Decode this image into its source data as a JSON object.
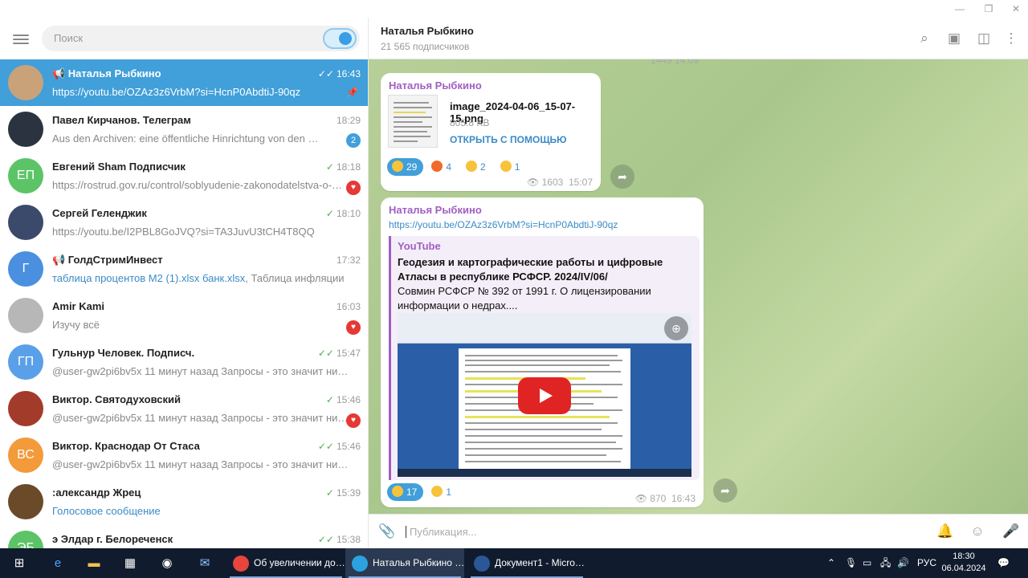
{
  "window": {
    "min": "—",
    "restore": "❐",
    "close": "✕"
  },
  "sidebar": {
    "search_placeholder": "Поиск",
    "chats": [
      {
        "name": "📢 Наталья Рыбкино",
        "time": "16:43",
        "preview": "https://youtu.be/OZAz3z6VrbM?si=HcnP0AbdtiJ-90qz",
        "check": "✓✓",
        "pinned": true,
        "avatar_color": "#c9a27a",
        "initials": ""
      },
      {
        "name": "Павел Кирчанов. Телеграм",
        "time": "18:29",
        "preview": "Aus den Archiven: eine öffentliche Hinrichtung von den …",
        "badge": "2",
        "avatar_color": "#2b3340",
        "initials": ""
      },
      {
        "name": "Евгений Sham Подписчик",
        "time": "18:18",
        "preview": "https://rostrud.gov.ru/control/soblyudenie-zakonodatelstva-o-…",
        "check": "✓",
        "heart": true,
        "avatar_color": "#5cc466",
        "initials": "ЕП"
      },
      {
        "name": "Сергей Геленджик",
        "time": "18:10",
        "preview": "https://youtu.be/I2PBL8GoJVQ?si=TA3JuvU3tCH4T8QQ",
        "check": "✓",
        "avatar_color": "#3b4a6b",
        "initials": ""
      },
      {
        "name": "📢 ГолдСтримИнвест",
        "time": "17:32",
        "preview_hl": "таблица процентов М2 (1).xlsx  банк.xlsx",
        "preview": ", Таблица инфляции",
        "avatar_color": "#4b8fe0",
        "initials": "Г"
      },
      {
        "name": "Amir Kami",
        "time": "16:03",
        "preview": "Изучу всё",
        "heart": true,
        "avatar_color": "#b7b7b7",
        "initials": ""
      },
      {
        "name": "Гульнур Человек. Подписч.",
        "time": "15:47",
        "preview": "@user-gw2pi6bv5x 11 минут назад Запросы - это значит ничего! …",
        "check": "✓✓",
        "avatar_color": "#5aa0e8",
        "initials": "ГП"
      },
      {
        "name": "Виктор. Святодуховский",
        "time": "15:46",
        "preview": "@user-gw2pi6bv5x 11 минут назад Запросы - это значит нич…",
        "check": "✓",
        "heart": true,
        "avatar_color": "#a33b2a",
        "initials": ""
      },
      {
        "name": "Виктор. Краснодар От Стаса",
        "time": "15:46",
        "preview": "@user-gw2pi6bv5x 11 минут назад Запросы - это значит ничего! …",
        "check": "✓✓",
        "avatar_color": "#f39a3a",
        "initials": "ВС"
      },
      {
        "name": ":александр Жрец",
        "time": "15:39",
        "preview_hl": "Голосовое сообщение",
        "preview": "",
        "check": "✓",
        "avatar_color": "#6b4a2a",
        "initials": ""
      },
      {
        "name": "э Элдар г. Белореченск",
        "time": "15:38",
        "preview": "",
        "check": "✓✓",
        "avatar_color": "#5cc466",
        "initials": "ЭБ"
      }
    ]
  },
  "chat": {
    "title": "Наталья Рыбкино",
    "subtitle": "21 565 подписчиков",
    "top_meta": "1449  14:09",
    "file_msg": {
      "sender": "Наталья Рыбкино",
      "file_name": "image_2024-04-06_15-07-15.png",
      "file_size": "805.8 KB",
      "open_label": "ОТКРЫТЬ С ПОМОЩЬЮ",
      "reactions": [
        {
          "count": "29",
          "color": "#f7c33b",
          "mine": true
        },
        {
          "count": "4",
          "color": "#f06a2a",
          "mine": false
        },
        {
          "count": "2",
          "color": "#f7c33b",
          "mine": false
        },
        {
          "count": "1",
          "color": "#f7c33b",
          "mine": false
        }
      ],
      "views": "1603",
      "time": "15:07"
    },
    "link_msg": {
      "sender": "Наталья Рыбкино",
      "url": "https://youtu.be/OZAz3z6VrbM?si=HcnP0AbdtiJ-90qz",
      "site": "YouTube",
      "title": "Геодезия и картографические работы  и цифровые Атласы в республике РСФСР.  2024/IV/06/",
      "desc": "Совмин РСФСР № 392 от 1991 г. О лицензировании информации о недрах....",
      "reactions": [
        {
          "count": "17",
          "color": "#f7c33b",
          "mine": true
        },
        {
          "count": "1",
          "color": "#f7c33b",
          "mine": false
        }
      ],
      "views": "870",
      "time": "16:43"
    },
    "compose_placeholder": "Публикация..."
  },
  "taskbar": {
    "apps": [
      {
        "label": "Об увеличении до…",
        "color": "#e8453c",
        "active": false
      },
      {
        "label": "Наталья Рыбкино …",
        "color": "#2aa3e0",
        "active": true
      },
      {
        "label": "Документ1 - Micro…",
        "color": "#2b5797",
        "active": false
      }
    ],
    "lang": "РУС",
    "time": "18:30",
    "date": "06.04.2024"
  }
}
